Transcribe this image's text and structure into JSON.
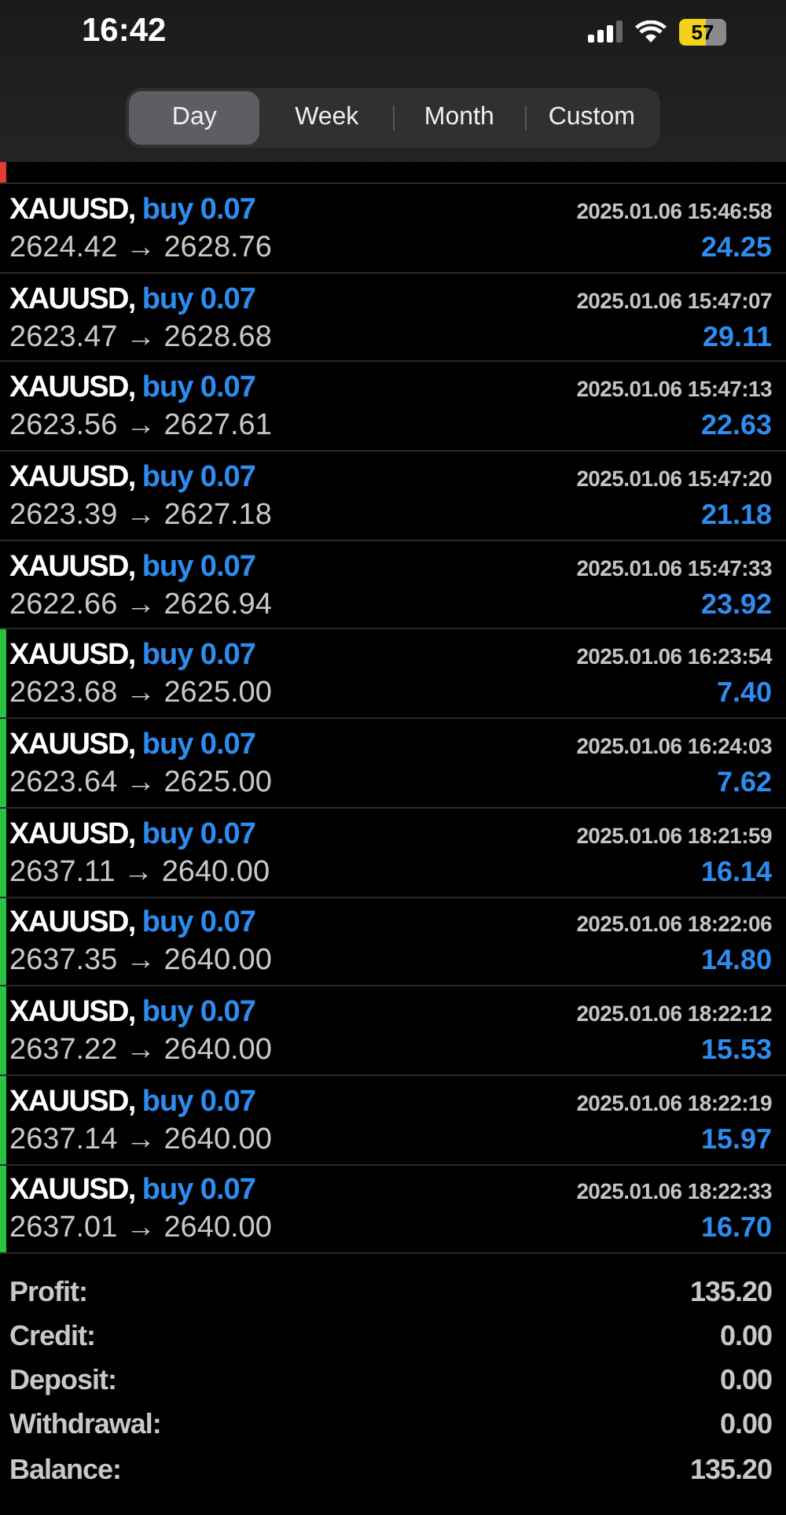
{
  "status_bar": {
    "time": "16:42",
    "battery": "57"
  },
  "period_tabs": [
    {
      "label": "Day",
      "selected": true
    },
    {
      "label": "Week",
      "selected": false
    },
    {
      "label": "Month",
      "selected": false
    },
    {
      "label": "Custom",
      "selected": false
    }
  ],
  "partial_row": {
    "color": "#e23b30"
  },
  "trades": [
    {
      "symbol": "XAUUSD,",
      "order": "buy 0.07",
      "time": "2025.01.06 15:46:58",
      "prices": "2624.42 → 2628.76",
      "profit": "24.25"
    },
    {
      "symbol": "XAUUSD,",
      "order": "buy 0.07",
      "time": "2025.01.06 15:47:07",
      "prices": "2623.47 → 2628.68",
      "profit": "29.11"
    },
    {
      "symbol": "XAUUSD,",
      "order": "buy 0.07",
      "time": "2025.01.06 15:47:13",
      "prices": "2623.56 → 2627.61",
      "profit": "22.63"
    },
    {
      "symbol": "XAUUSD,",
      "order": "buy 0.07",
      "time": "2025.01.06 15:47:20",
      "prices": "2623.39 → 2627.18",
      "profit": "21.18"
    },
    {
      "symbol": "XAUUSD,",
      "order": "buy 0.07",
      "time": "2025.01.06 15:47:33",
      "prices": "2622.66 → 2626.94",
      "profit": "23.92"
    },
    {
      "symbol": "XAUUSD,",
      "order": "buy 0.07",
      "time": "2025.01.06 16:23:54",
      "prices": "2623.68 → 2625.00",
      "profit": "7.40",
      "color": "#2bc23f"
    },
    {
      "symbol": "XAUUSD,",
      "order": "buy 0.07",
      "time": "2025.01.06 16:24:03",
      "prices": "2623.64 → 2625.00",
      "profit": "7.62",
      "color": "#2bc23f"
    },
    {
      "symbol": "XAUUSD,",
      "order": "buy 0.07",
      "time": "2025.01.06 18:21:59",
      "prices": "2637.11 → 2640.00",
      "profit": "16.14",
      "color": "#2bc23f"
    },
    {
      "symbol": "XAUUSD,",
      "order": "buy 0.07",
      "time": "2025.01.06 18:22:06",
      "prices": "2637.35 → 2640.00",
      "profit": "14.80",
      "color": "#2bc23f"
    },
    {
      "symbol": "XAUUSD,",
      "order": "buy 0.07",
      "time": "2025.01.06 18:22:12",
      "prices": "2637.22 → 2640.00",
      "profit": "15.53",
      "color": "#2bc23f"
    },
    {
      "symbol": "XAUUSD,",
      "order": "buy 0.07",
      "time": "2025.01.06 18:22:19",
      "prices": "2637.14 → 2640.00",
      "profit": "15.97",
      "color": "#2bc23f"
    },
    {
      "symbol": "XAUUSD,",
      "order": "buy 0.07",
      "time": "2025.01.06 18:22:33",
      "prices": "2637.01 → 2640.00",
      "profit": "16.70",
      "color": "#2bc23f"
    }
  ],
  "summary": [
    {
      "label": "Profit:",
      "value": "135.20"
    },
    {
      "label": "Credit:",
      "value": "0.00"
    },
    {
      "label": "Deposit:",
      "value": "0.00"
    },
    {
      "label": "Withdrawal:",
      "value": "0.00"
    },
    {
      "label": "Balance:",
      "value": "135.20"
    }
  ]
}
